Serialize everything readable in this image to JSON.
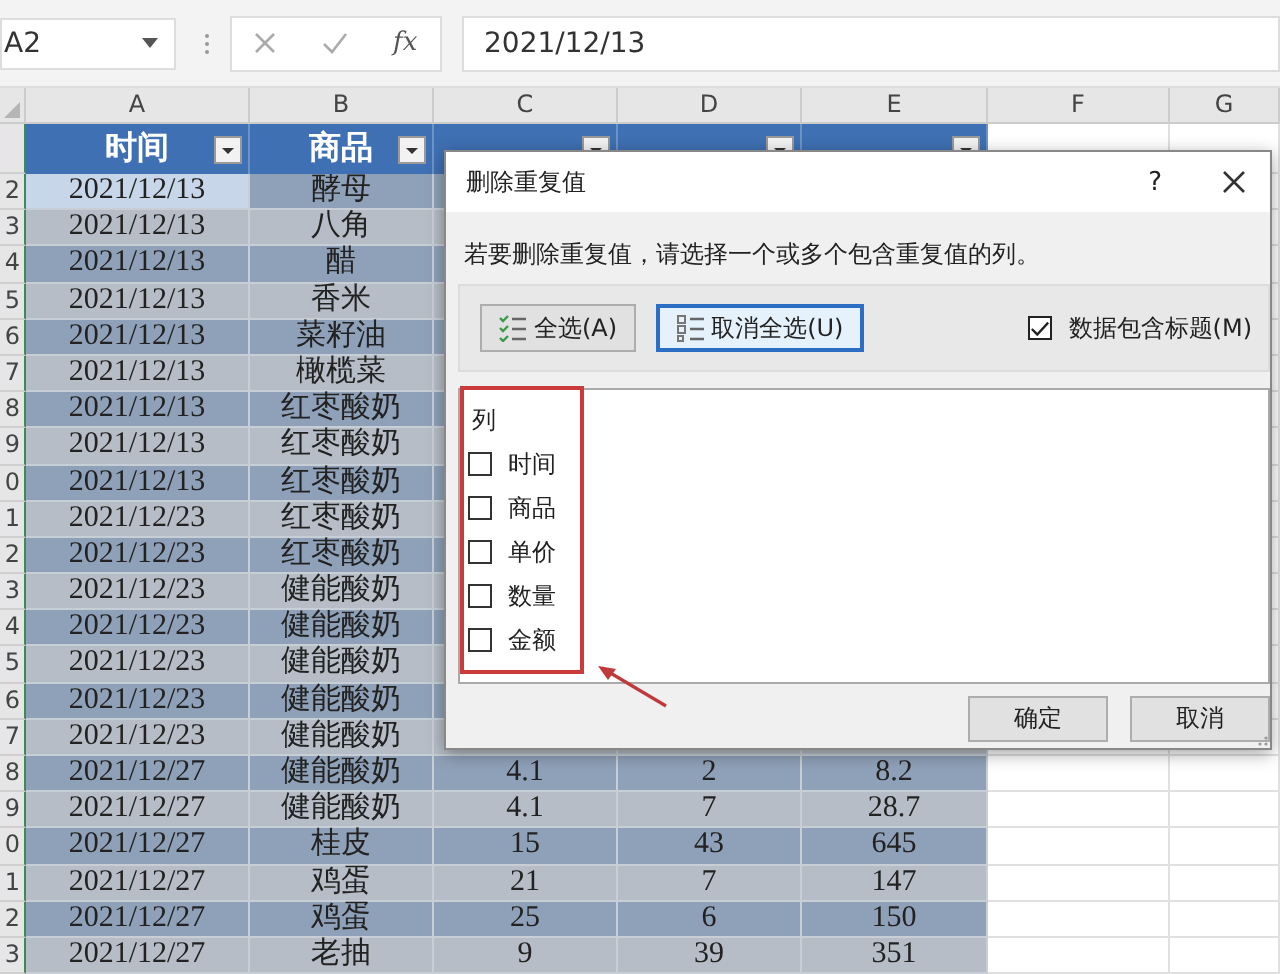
{
  "formula_bar": {
    "name_box": "A2",
    "fx": "fx",
    "formula": "2021/12/13"
  },
  "column_letters": [
    "A",
    "B",
    "C",
    "D",
    "E",
    "F",
    "G"
  ],
  "table": {
    "headers": [
      "时间",
      "商品"
    ],
    "rows": [
      {
        "row_number": "2",
        "selected": true,
        "cells": [
          "2021/12/13",
          "酵母"
        ]
      },
      {
        "row_number": "3",
        "selected": false,
        "cells": [
          "2021/12/13",
          "八角"
        ]
      },
      {
        "row_number": "4",
        "selected": false,
        "cells": [
          "2021/12/13",
          "醋"
        ]
      },
      {
        "row_number": "5",
        "selected": false,
        "cells": [
          "2021/12/13",
          "香米"
        ]
      },
      {
        "row_number": "6",
        "selected": false,
        "cells": [
          "2021/12/13",
          "菜籽油"
        ]
      },
      {
        "row_number": "7",
        "selected": false,
        "cells": [
          "2021/12/13",
          "橄榄菜"
        ]
      },
      {
        "row_number": "8",
        "selected": false,
        "cells": [
          "2021/12/13",
          "红枣酸奶"
        ]
      },
      {
        "row_number": "9",
        "selected": false,
        "cells": [
          "2021/12/13",
          "红枣酸奶"
        ]
      },
      {
        "row_number": "0",
        "selected": false,
        "cells": [
          "2021/12/13",
          "红枣酸奶"
        ]
      },
      {
        "row_number": "1",
        "selected": false,
        "cells": [
          "2021/12/23",
          "红枣酸奶"
        ]
      },
      {
        "row_number": "2",
        "selected": false,
        "cells": [
          "2021/12/23",
          "红枣酸奶"
        ]
      },
      {
        "row_number": "3",
        "selected": false,
        "cells": [
          "2021/12/23",
          "健能酸奶"
        ]
      },
      {
        "row_number": "4",
        "selected": false,
        "cells": [
          "2021/12/23",
          "健能酸奶"
        ]
      },
      {
        "row_number": "5",
        "selected": false,
        "cells": [
          "2021/12/23",
          "健能酸奶"
        ]
      },
      {
        "row_number": "6",
        "selected": false,
        "cells": [
          "2021/12/23",
          "健能酸奶"
        ]
      },
      {
        "row_number": "7",
        "selected": false,
        "cells": [
          "2021/12/23",
          "健能酸奶"
        ]
      },
      {
        "row_number": "8",
        "selected": false,
        "cells": [
          "2021/12/27",
          "健能酸奶",
          "4.1",
          "2",
          "8.2"
        ]
      },
      {
        "row_number": "9",
        "selected": false,
        "cells": [
          "2021/12/27",
          "健能酸奶",
          "4.1",
          "7",
          "28.7"
        ]
      },
      {
        "row_number": "0",
        "selected": false,
        "cells": [
          "2021/12/27",
          "桂皮",
          "15",
          "43",
          "645"
        ]
      },
      {
        "row_number": "1",
        "selected": false,
        "cells": [
          "2021/12/27",
          "鸡蛋",
          "21",
          "7",
          "147"
        ]
      },
      {
        "row_number": "2",
        "selected": false,
        "cells": [
          "2021/12/27",
          "鸡蛋",
          "25",
          "6",
          "150"
        ]
      },
      {
        "row_number": "3",
        "selected": false,
        "cells": [
          "2021/12/27",
          "老抽",
          "9",
          "39",
          "351"
        ]
      }
    ]
  },
  "dialog": {
    "title": "删除重复值",
    "help": "?",
    "instruction": "若要删除重复值，请选择一个或多个包含重复值的列。",
    "tool_buttons": [
      {
        "label": "全选(A)",
        "focused": false
      },
      {
        "label": "取消全选(U)",
        "focused": true
      }
    ],
    "header_checkbox": {
      "label": "数据包含标题(M)",
      "checked": true
    },
    "list_heading": "列",
    "columns": [
      {
        "label": "时间",
        "checked": false
      },
      {
        "label": "商品",
        "checked": false
      },
      {
        "label": "单价",
        "checked": false
      },
      {
        "label": "数量",
        "checked": false
      },
      {
        "label": "金额",
        "checked": false
      }
    ],
    "actions": [
      "确定",
      "取消"
    ]
  }
}
